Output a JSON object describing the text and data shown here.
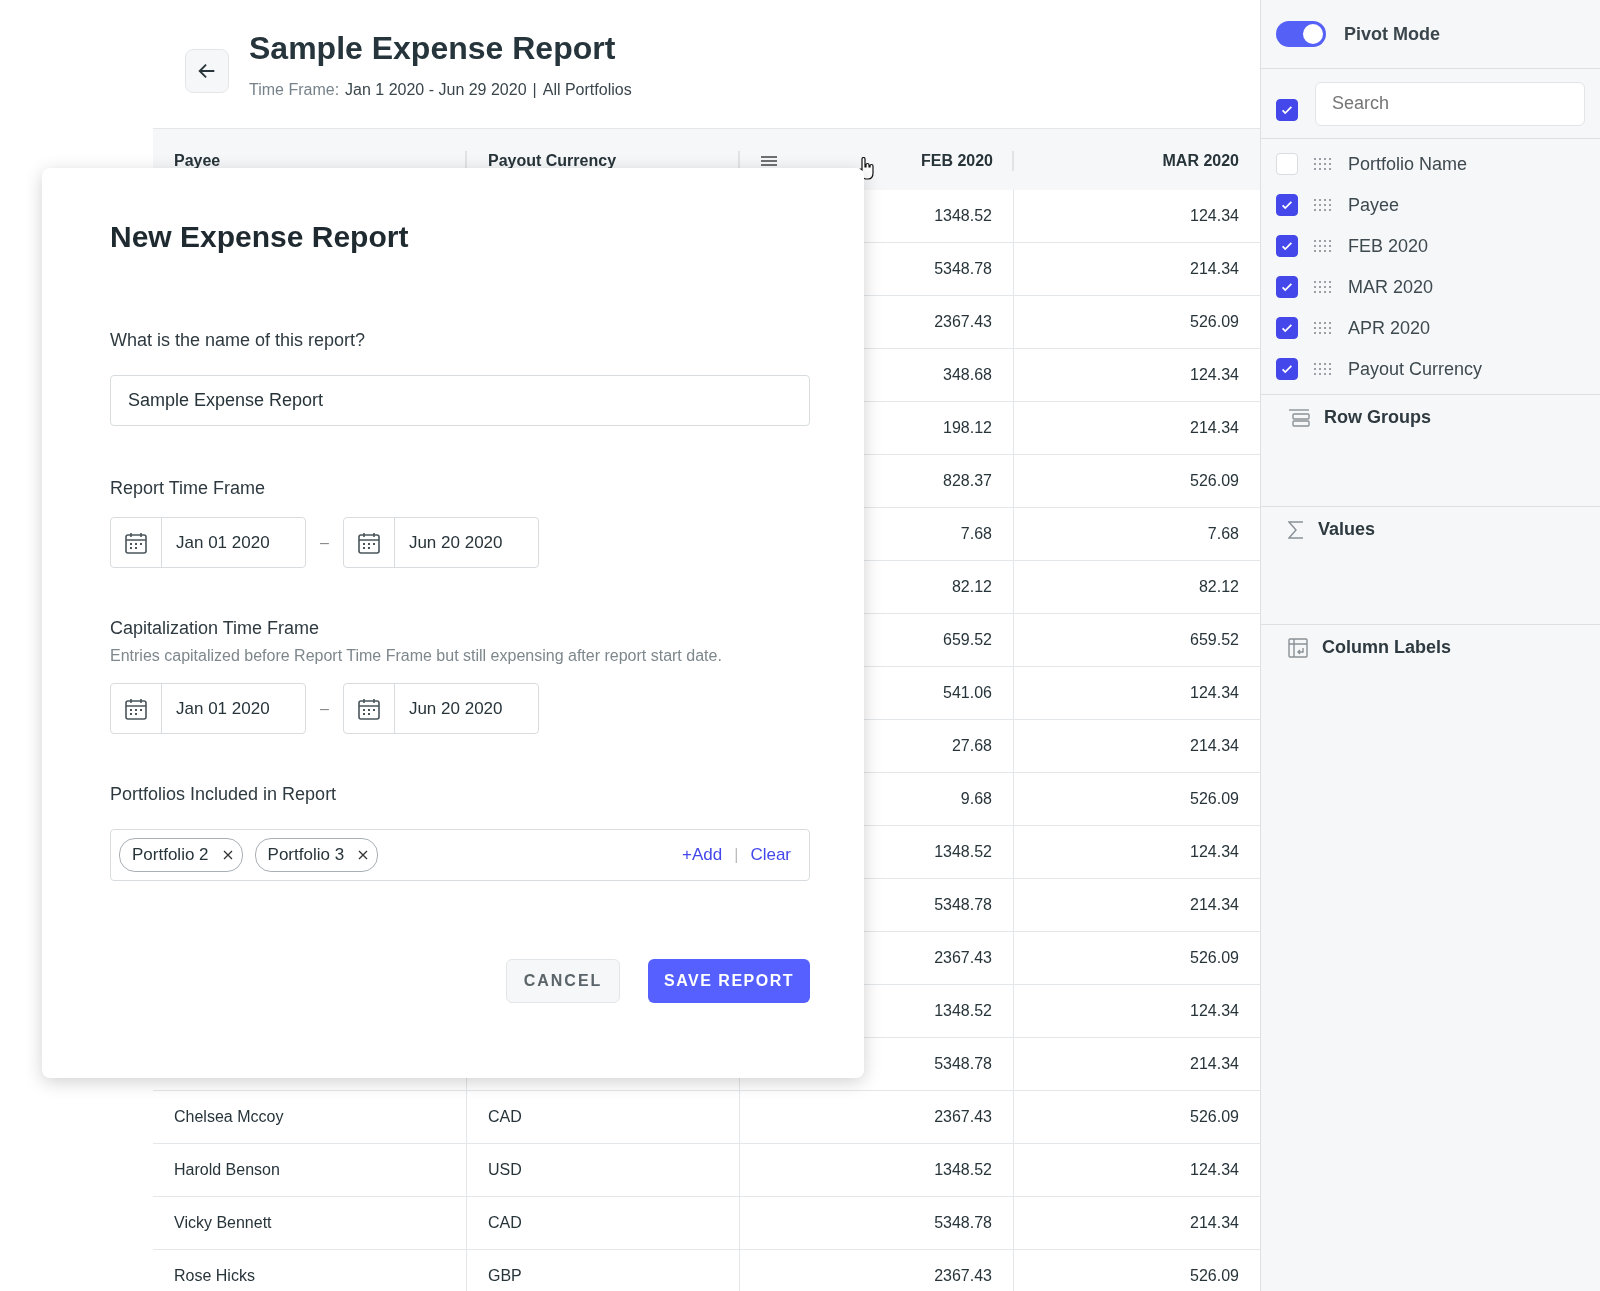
{
  "header": {
    "title": "Sample Expense Report",
    "time_frame_label": "Time Frame:",
    "time_frame": "Jan 1 2020 - Jun 29 2020",
    "separator": "|",
    "portfolios": "All Portfolios"
  },
  "table": {
    "columns": [
      "Payee",
      "Payout Currency",
      "FEB 2020",
      "MAR 2020"
    ],
    "rows": [
      {
        "feb": "1348.52",
        "mar": "124.34"
      },
      {
        "feb": "5348.78",
        "mar": "214.34"
      },
      {
        "feb": "2367.43",
        "mar": "526.09"
      },
      {
        "feb": "348.68",
        "mar": "124.34"
      },
      {
        "feb": "198.12",
        "mar": "214.34"
      },
      {
        "feb": "828.37",
        "mar": "526.09"
      },
      {
        "feb": "7.68",
        "mar": "7.68"
      },
      {
        "feb": "82.12",
        "mar": "82.12"
      },
      {
        "feb": "659.52",
        "mar": "659.52"
      },
      {
        "feb": "541.06",
        "mar": "124.34"
      },
      {
        "feb": "27.68",
        "mar": "214.34"
      },
      {
        "feb": "9.68",
        "mar": "526.09"
      },
      {
        "feb": "1348.52",
        "mar": "124.34"
      },
      {
        "feb": "5348.78",
        "mar": "214.34"
      },
      {
        "feb": "2367.43",
        "mar": "526.09"
      },
      {
        "feb": "1348.52",
        "mar": "124.34"
      },
      {
        "feb": "5348.78",
        "mar": "214.34"
      },
      {
        "payee": "Chelsea Mccoy",
        "currency": "CAD",
        "feb": "2367.43",
        "mar": "526.09"
      },
      {
        "payee": "Harold Benson",
        "currency": "USD",
        "feb": "1348.52",
        "mar": "124.34"
      },
      {
        "payee": "Vicky Bennett",
        "currency": "CAD",
        "feb": "5348.78",
        "mar": "214.34"
      },
      {
        "payee": "Rose Hicks",
        "currency": "GBP",
        "feb": "2367.43",
        "mar": "526.09"
      }
    ]
  },
  "dialog": {
    "title": "New Expense Report",
    "name_label": "What is the name of this report?",
    "name_value": "Sample Expense Report",
    "report_time_frame": {
      "label": "Report Time Frame",
      "start": "Jan 01 2020",
      "separator": "–",
      "end": "Jun 20 2020"
    },
    "capitalization_time_frame": {
      "label": "Capitalization Time Frame",
      "description": "Entries capitalized before Report Time Frame but still expensing after report start date.",
      "start": "Jan 01 2020",
      "separator": "–",
      "end": "Jun 20 2020"
    },
    "portfolios_label": "Portfolios Included in Report",
    "portfolio_tags": [
      "Portfolio 2",
      "Portfolio 3"
    ],
    "add_link": "+Add",
    "link_separator": "|",
    "clear_link": "Clear",
    "buttons": {
      "cancel": "CANCEL",
      "save": "SAVE REPORT"
    }
  },
  "side_panel": {
    "pivot_mode": {
      "label": "Pivot Mode",
      "on": true
    },
    "select_all": {
      "checked": true
    },
    "search": {
      "placeholder": "Search"
    },
    "columns": [
      {
        "label": "Portfolio Name",
        "checked": false
      },
      {
        "label": "Payee",
        "checked": true
      },
      {
        "label": "FEB 2020",
        "checked": true
      },
      {
        "label": "MAR 2020",
        "checked": true
      },
      {
        "label": "APR 2020",
        "checked": true
      },
      {
        "label": "Payout Currency",
        "checked": true
      }
    ],
    "sections": [
      {
        "kind": "row_groups",
        "label": "Row Groups"
      },
      {
        "kind": "values",
        "label": "Values"
      },
      {
        "kind": "column_labels",
        "label": "Column Labels"
      }
    ]
  }
}
